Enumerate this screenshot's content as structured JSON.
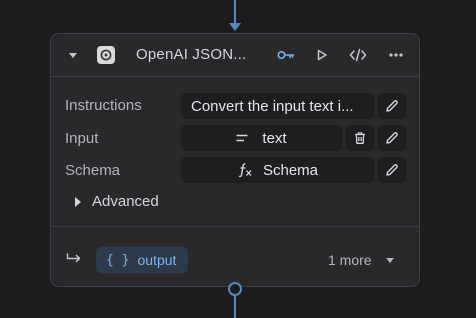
{
  "node": {
    "title": "OpenAI JSON...",
    "header_icons": [
      "key-icon",
      "play-icon",
      "code-icon",
      "more-icon"
    ]
  },
  "rows": {
    "instructions": {
      "label": "Instructions",
      "value": "Convert the input text i..."
    },
    "input": {
      "label": "Input",
      "value": "text",
      "icon": "lines-icon"
    },
    "schema": {
      "label": "Schema",
      "value": "Schema",
      "icon": "function-icon"
    }
  },
  "advanced_label": "Advanced",
  "footer": {
    "output_label": "output",
    "output_brace": "{ }",
    "more_label": "1 more"
  },
  "colors": {
    "accent": "#7eaee6",
    "connector": "#5b86b8",
    "node_bg": "#29292c",
    "canvas_bg": "#1c1c1e"
  }
}
